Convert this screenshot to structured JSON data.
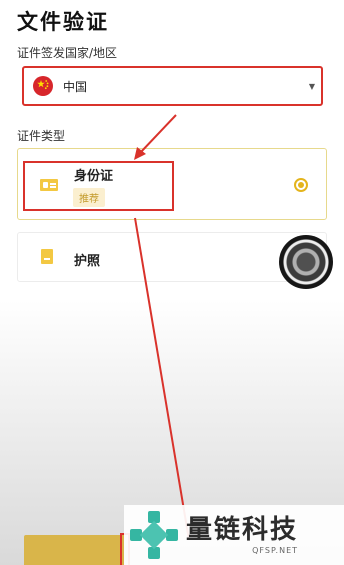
{
  "page": {
    "title": "文件验证"
  },
  "country": {
    "label": "证件签发国家/地区",
    "selected": "中国",
    "caret": "▼",
    "flag_icon": "china-flag-icon"
  },
  "doc_type": {
    "label": "证件类型",
    "options": [
      {
        "name": "身份证",
        "badge": "推荐",
        "icon": "id-card-icon",
        "selected": true
      },
      {
        "name": "护照",
        "icon": "passport-icon",
        "selected": false
      }
    ]
  },
  "watermark": {
    "brand": "量链科技",
    "domain": "QFSP.NET"
  },
  "colors": {
    "accent": "#e4b41c",
    "highlight": "#d9322b",
    "badge_bg": "#fbefcf",
    "button": "#d9b54a"
  }
}
